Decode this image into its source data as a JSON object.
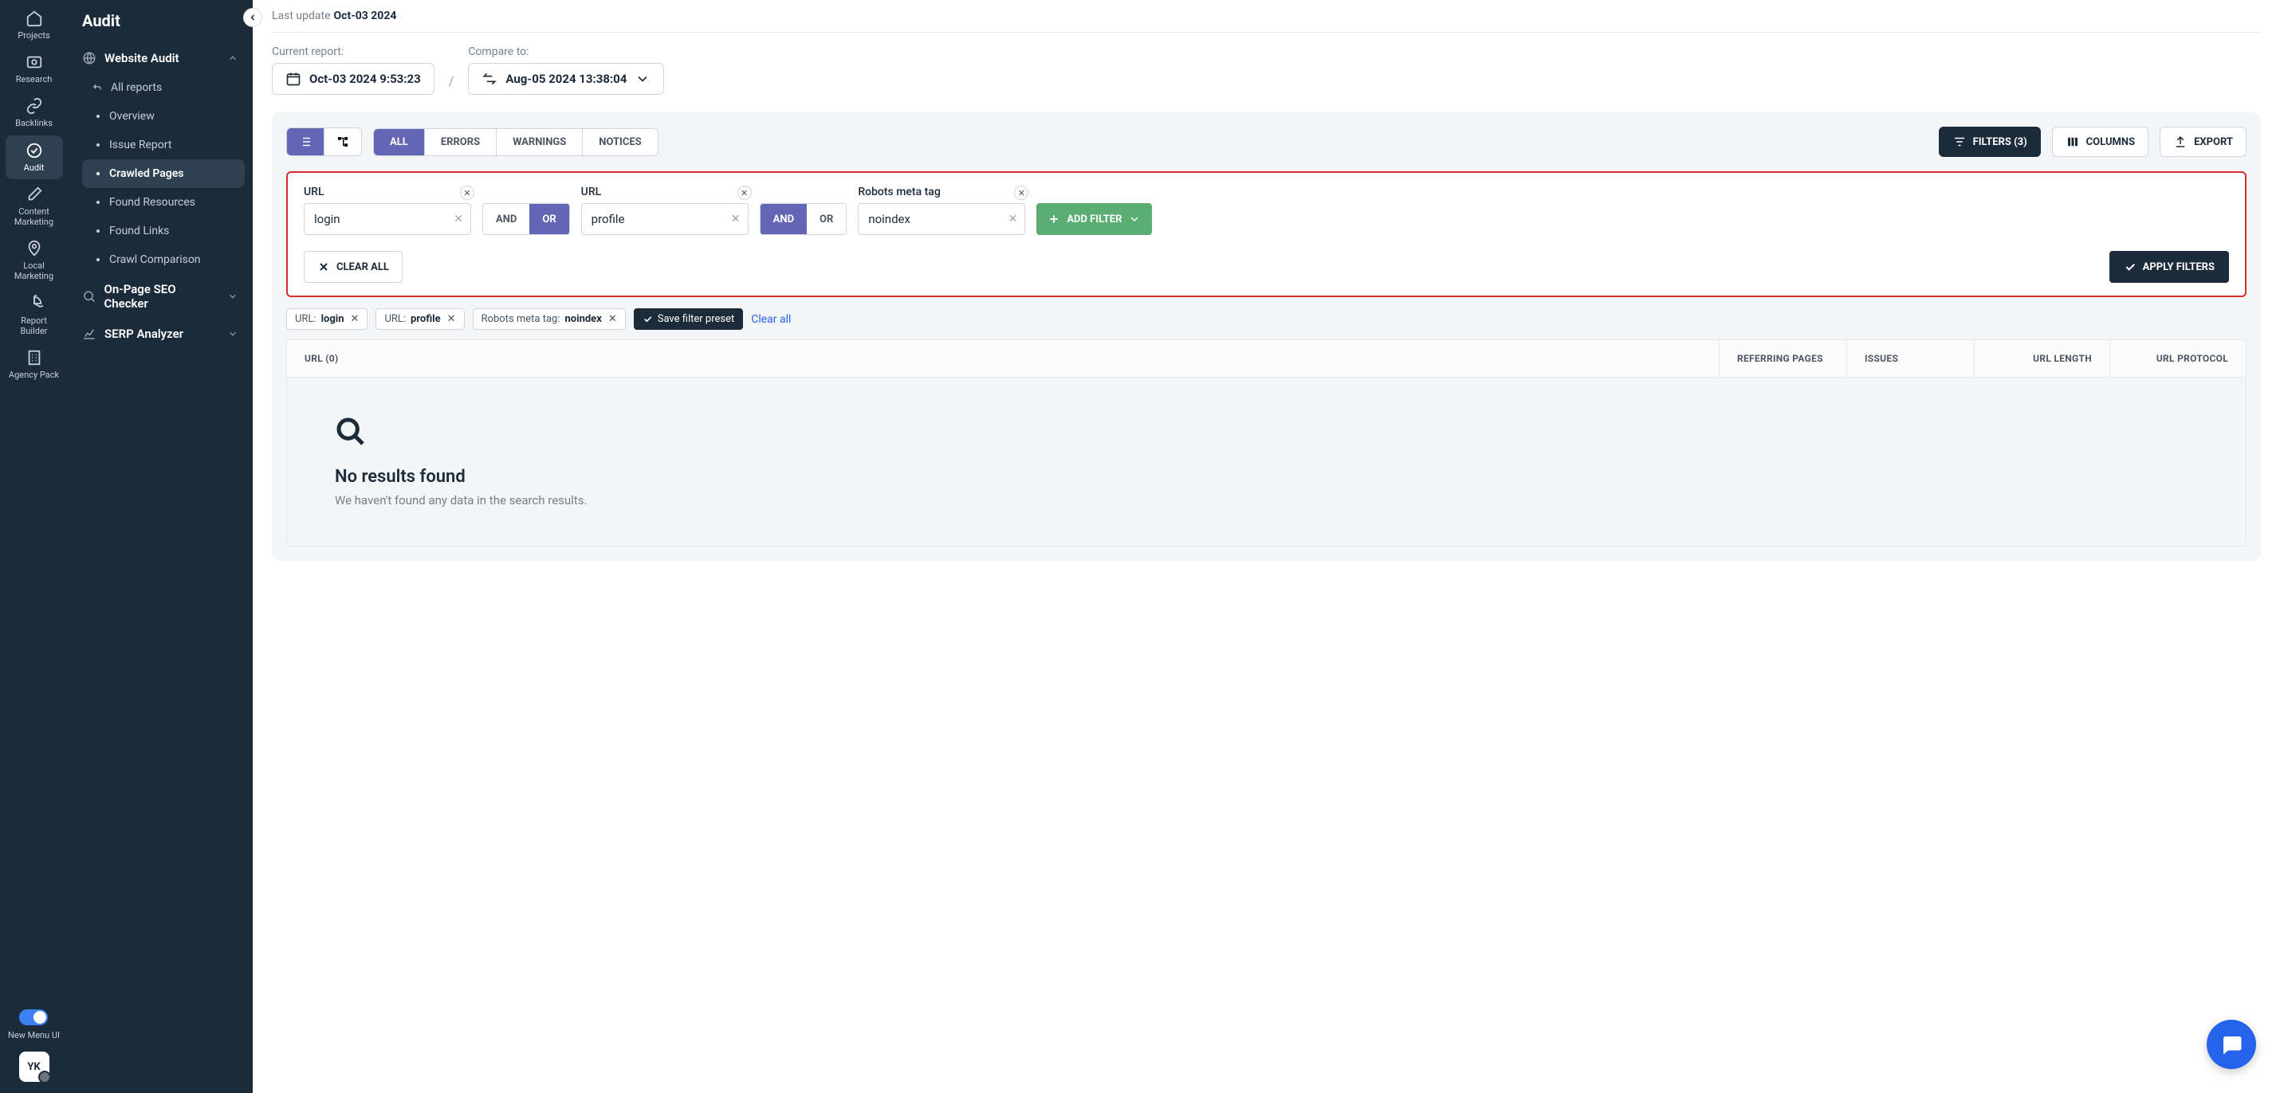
{
  "mini_nav": {
    "items": [
      {
        "label": "Projects"
      },
      {
        "label": "Research"
      },
      {
        "label": "Backlinks"
      },
      {
        "label": "Audit"
      },
      {
        "label": "Content Marketing"
      },
      {
        "label": "Local Marketing"
      },
      {
        "label": "Report Builder"
      },
      {
        "label": "Agency Pack"
      }
    ],
    "toggle_label": "New Menu UI",
    "user_initials": "YK"
  },
  "sidebar": {
    "title": "Audit",
    "groups": [
      {
        "label": "Website Audit",
        "items": [
          {
            "label": "All reports"
          },
          {
            "label": "Overview"
          },
          {
            "label": "Issue Report"
          },
          {
            "label": "Crawled Pages"
          },
          {
            "label": "Found Resources"
          },
          {
            "label": "Found Links"
          },
          {
            "label": "Crawl Comparison"
          }
        ]
      },
      {
        "label": "On-Page SEO Checker"
      },
      {
        "label": "SERP Analyzer"
      }
    ]
  },
  "topbar": {
    "last_update_label": "Last update",
    "last_update_date": "Oct-03 2024"
  },
  "reports": {
    "current_label": "Current report:",
    "current_value": "Oct-03 2024 9:53:23",
    "compare_label": "Compare to:",
    "compare_value": "Aug-05 2024 13:38:04"
  },
  "toolbar": {
    "tabs": {
      "all": "ALL",
      "errors": "ERRORS",
      "warnings": "WARNINGS",
      "notices": "NOTICES"
    },
    "filters_btn": "FILTERS (3)",
    "columns_btn": "COLUMNS",
    "export_btn": "EXPORT"
  },
  "filters": {
    "blocks": [
      {
        "label": "URL",
        "value": "login",
        "logic": "OR"
      },
      {
        "label": "URL",
        "value": "profile",
        "logic": "AND"
      },
      {
        "label": "Robots meta tag",
        "value": "noindex"
      }
    ],
    "logic_and": "AND",
    "logic_or": "OR",
    "add_filter": "ADD FILTER",
    "clear_all": "CLEAR ALL",
    "apply": "APPLY FILTERS"
  },
  "chips": [
    {
      "key": "URL:",
      "val": "login"
    },
    {
      "key": "URL:",
      "val": "profile"
    },
    {
      "key": "Robots meta tag:",
      "val": "noindex"
    }
  ],
  "save_preset": "Save filter preset",
  "clear_all_link": "Clear all",
  "table": {
    "headers": {
      "url": "URL  (0)",
      "ref": "REFERRING PAGES",
      "issues": "ISSUES",
      "len": "URL LENGTH",
      "proto": "URL PROTOCOL"
    }
  },
  "empty": {
    "title": "No results found",
    "sub": "We haven't found any data in the search results."
  }
}
